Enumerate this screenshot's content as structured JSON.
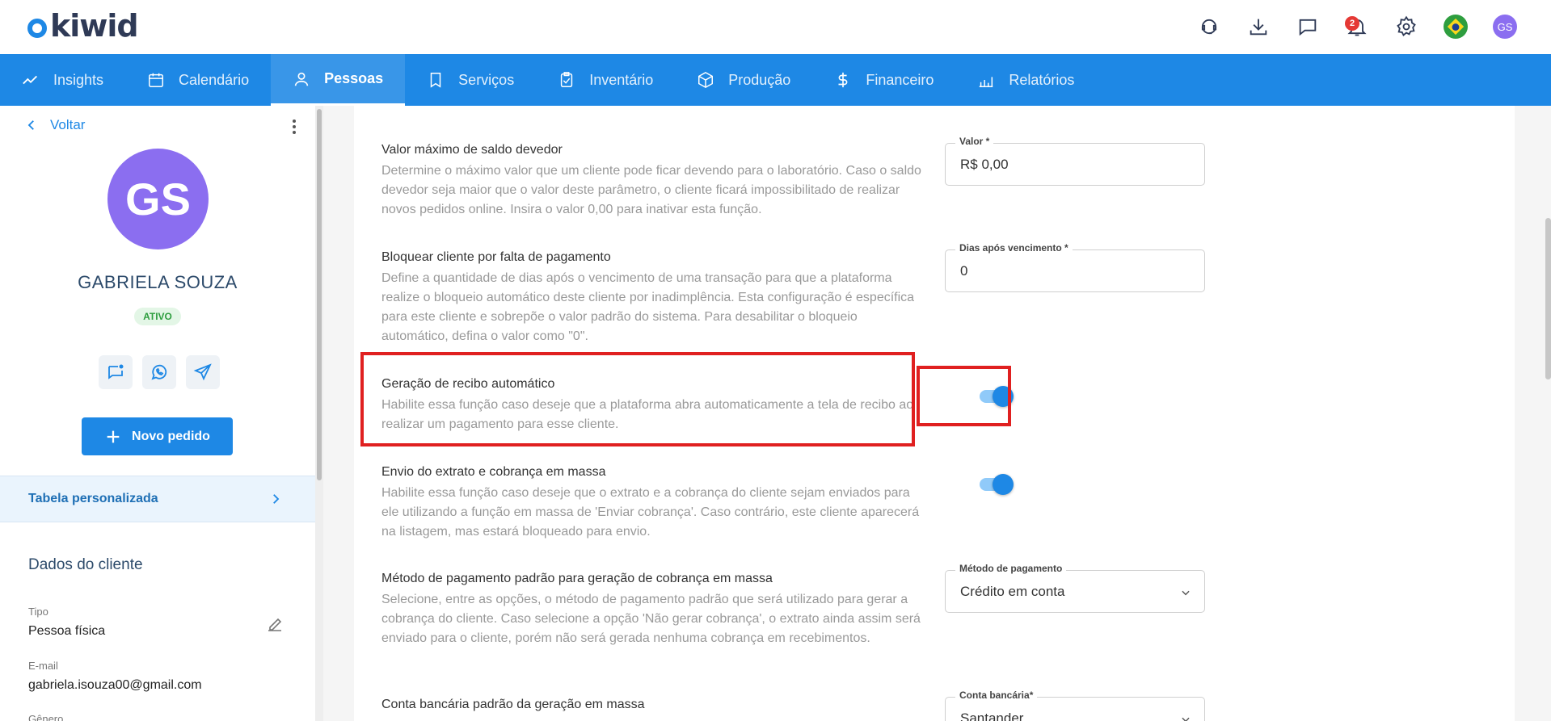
{
  "header": {
    "logo": "kiwid",
    "notifications_count": "2",
    "user_initials": "GS",
    "icons": [
      "support-icon",
      "download-icon",
      "chat-icon",
      "bell-icon",
      "gear-icon"
    ]
  },
  "nav": {
    "items": [
      {
        "label": "Insights",
        "icon": "trend-icon"
      },
      {
        "label": "Calendário",
        "icon": "calendar-icon"
      },
      {
        "label": "Pessoas",
        "icon": "person-icon",
        "active": true
      },
      {
        "label": "Serviços",
        "icon": "bookmark-icon"
      },
      {
        "label": "Inventário",
        "icon": "clipboard-icon"
      },
      {
        "label": "Produção",
        "icon": "box-icon"
      },
      {
        "label": "Financeiro",
        "icon": "dollar-icon"
      },
      {
        "label": "Relatórios",
        "icon": "chart-icon"
      }
    ]
  },
  "sidebar": {
    "back_label": "Voltar",
    "avatar_initials": "GS",
    "name": "GABRIELA SOUZA",
    "status": "ATIVO",
    "new_order_label": "Novo pedido",
    "custom_table_label": "Tabela personalizada",
    "section_title": "Dados do cliente",
    "fields": [
      {
        "label": "Tipo",
        "value": "Pessoa física"
      },
      {
        "label": "E-mail",
        "value": "gabriela.isouza00@gmail.com"
      },
      {
        "label": "Gênero",
        "value": ""
      }
    ]
  },
  "settings": [
    {
      "title": "Valor máximo de saldo devedor",
      "desc": "Determine o máximo valor que um cliente pode ficar devendo para o laboratório. Caso o saldo devedor seja maior que o valor deste parâmetro, o cliente ficará impossibilitado de realizar novos pedidos online. Insira o valor 0,00 para inativar esta função.",
      "field_label": "Valor *",
      "field_value": "R$ 0,00"
    },
    {
      "title": "Bloquear cliente por falta de pagamento",
      "desc": "Define a quantidade de dias após o vencimento de uma transação para que a plataforma realize o bloqueio automático deste cliente por inadimplência. Esta configuração é específica para este cliente e sobrepõe o valor padrão do sistema. Para desabilitar o bloqueio automático, defina o valor como \"0\".",
      "field_label": "Dias após vencimento *",
      "field_value": "0"
    },
    {
      "title": "Geração de recibo automático",
      "desc": "Habilite essa função caso deseje que a plataforma abra automaticamente a tela de recibo ao realizar um pagamento para esse cliente.",
      "toggle": true
    },
    {
      "title": "Envio do extrato e cobrança em massa",
      "desc": "Habilite essa função caso deseje que o extrato e a cobrança do cliente sejam enviados para ele utilizando a função em massa de 'Enviar cobrança'. Caso contrário, este cliente aparecerá na listagem, mas estará bloqueado para envio.",
      "toggle": true
    },
    {
      "title": "Método de pagamento padrão para geração de cobrança em massa",
      "desc": "Selecione, entre as opções, o método de pagamento padrão que será utilizado para gerar a cobrança do cliente. Caso selecione a opção 'Não gerar cobrança', o extrato ainda assim será enviado para o cliente, porém não será gerada nenhuma cobrança em recebimentos.",
      "field_label": "Método de pagamento",
      "field_value": "Crédito em conta"
    },
    {
      "title": "Conta bancária padrão da geração em massa",
      "desc": "",
      "field_label": "Conta bancária*",
      "field_value": "Santander"
    }
  ]
}
